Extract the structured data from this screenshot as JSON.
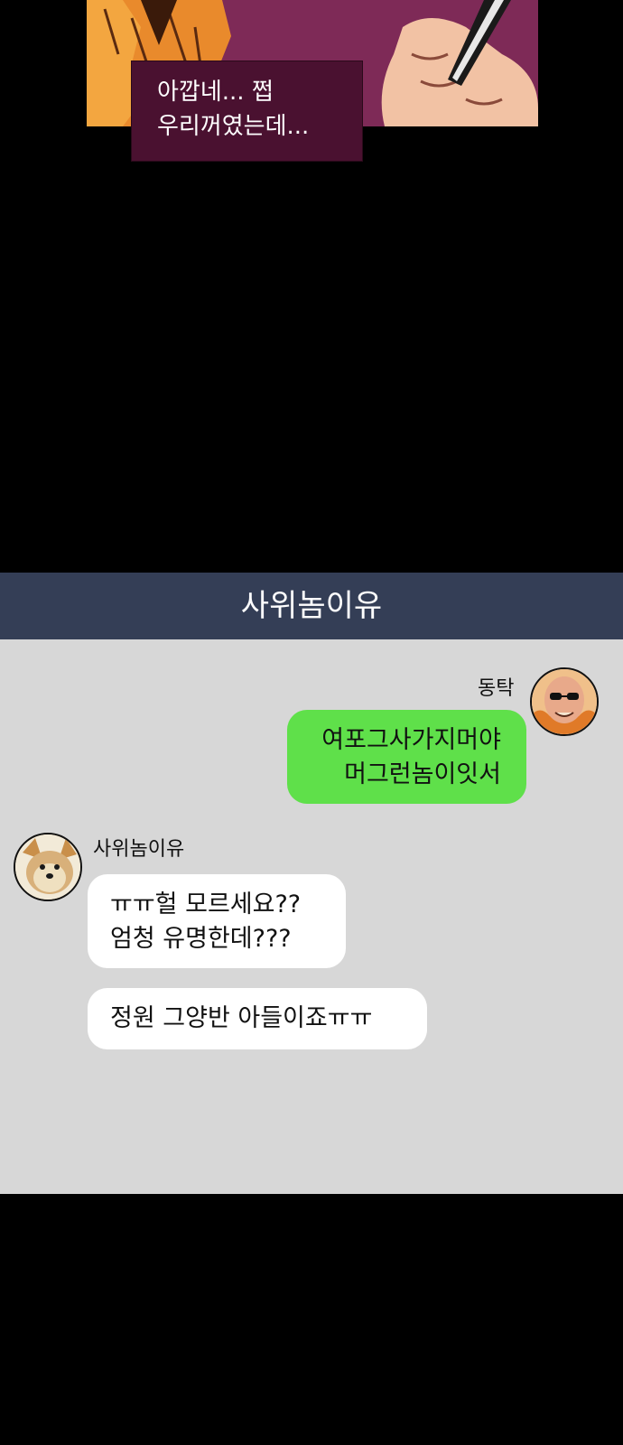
{
  "comic": {
    "caption": "아깝네... 쩝\n우리꺼였는데..."
  },
  "chat": {
    "header_title": "사위놈이유",
    "messages": [
      {
        "direction": "outgoing",
        "sender": "동탁",
        "avatar_icon": "bald-man-sunglasses-avatar",
        "text": "여포그사가지머야\n머그런놈이잇서"
      },
      {
        "direction": "incoming",
        "sender": "사위놈이유",
        "avatar_icon": "yorkshire-terrier-avatar",
        "text": "ㅠㅠ헐 모르세요??\n엄청 유명한데???"
      },
      {
        "direction": "incoming",
        "sender": "사위놈이유",
        "text": "정원 그양반 아들이죠ㅠㅠ"
      }
    ]
  },
  "colors": {
    "page_background": "#000000",
    "chat_background": "#d7d7d7",
    "chat_header": "#343e56",
    "outgoing_bubble": "#5fe04a",
    "incoming_bubble": "#ffffff",
    "caption_box": "#4a1130"
  }
}
